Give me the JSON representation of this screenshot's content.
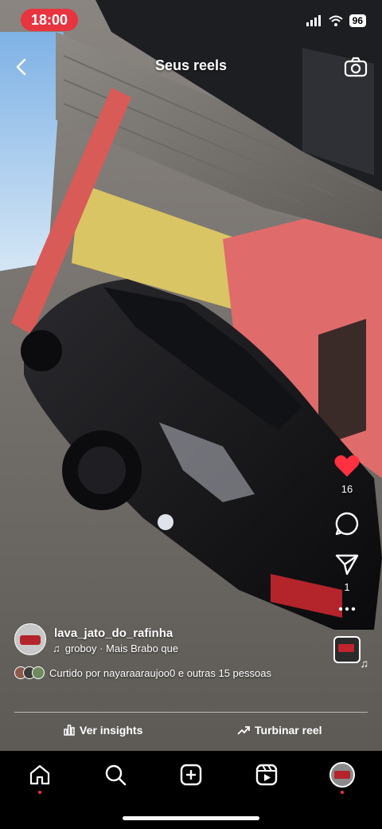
{
  "status_bar": {
    "time": "18:00",
    "battery": "96"
  },
  "header": {
    "title": "Seus reels"
  },
  "actions": {
    "likes": "16",
    "shares": "1"
  },
  "post": {
    "username": "lava_jato_do_rafinha",
    "audio": "groboy · Mais Brabo que",
    "liked_by": "Curtido por nayaraaraujoo0 e outras 15 pessoas"
  },
  "footer": {
    "insights_label": "Ver insights",
    "boost_label": "Turbinar reel"
  },
  "icons": [
    "back-icon",
    "camera-icon",
    "heart-icon",
    "comment-icon",
    "share-icon",
    "more-icon",
    "audio-thumb-icon",
    "music-icon",
    "insights-icon",
    "boost-icon",
    "home-icon",
    "search-icon",
    "create-icon",
    "reels-icon",
    "profile-avatar"
  ],
  "colors": {
    "accent": "#ff3040",
    "time_pill": "#e8343f",
    "like": "#ff3040"
  }
}
